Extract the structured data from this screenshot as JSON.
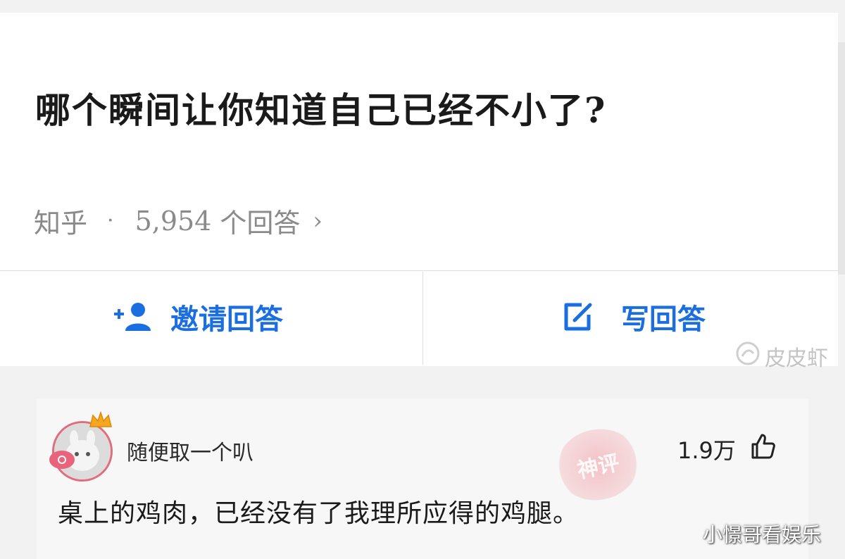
{
  "question": {
    "title": "哪个瞬间让你知道自己已经不小了?",
    "source": "知乎",
    "separator": "·",
    "answer_count": "5,954",
    "answer_count_suffix": "个回答",
    "chevron": "›"
  },
  "actions": {
    "invite_label": "邀请回答",
    "write_label": "写回答",
    "invite_icon": "add-user-icon",
    "write_icon": "edit-icon"
  },
  "answer": {
    "username": "随便取一个叭",
    "likes": "1.9万",
    "text": "桌上的鸡肉，已经没有了我理所应得的鸡腿。",
    "stamp": "神评"
  },
  "watermarks": {
    "app": "皮皮虾",
    "author": "小憬哥看娱乐"
  },
  "colors": {
    "accent": "#1a6ee0",
    "stamp": "#e8637b"
  }
}
